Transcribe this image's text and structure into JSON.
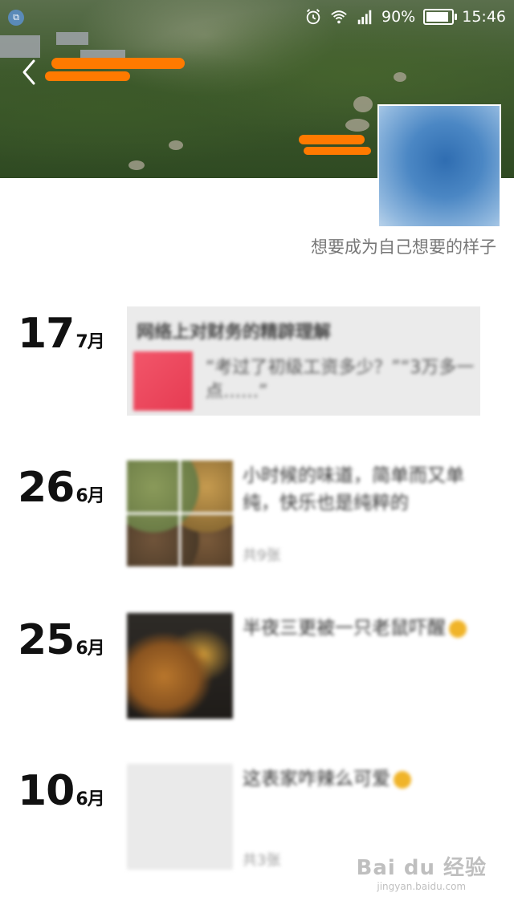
{
  "status_bar": {
    "battery": "90%",
    "time": "15:46"
  },
  "profile": {
    "signature": "想要成为自己想要的样子"
  },
  "posts": [
    {
      "day": "17",
      "month": "7月",
      "type": "article",
      "title": "网络上对财务的精辟理解",
      "excerpt": "“考过了初级工资多少？”“3万多一点……”"
    },
    {
      "day": "26",
      "month": "6月",
      "type": "photos",
      "text": "小时候的味道，简单而又单纯，快乐也是纯粹的",
      "count": "共9张"
    },
    {
      "day": "25",
      "month": "6月",
      "type": "photo",
      "text": "半夜三更被一只老鼠吓醒"
    },
    {
      "day": "10",
      "month": "6月",
      "type": "photos",
      "text": "这表家咋辣么可爱",
      "count": "共3张"
    }
  ],
  "watermark": {
    "main": "Bai du 经验",
    "sub": "jingyan.baidu.com"
  }
}
